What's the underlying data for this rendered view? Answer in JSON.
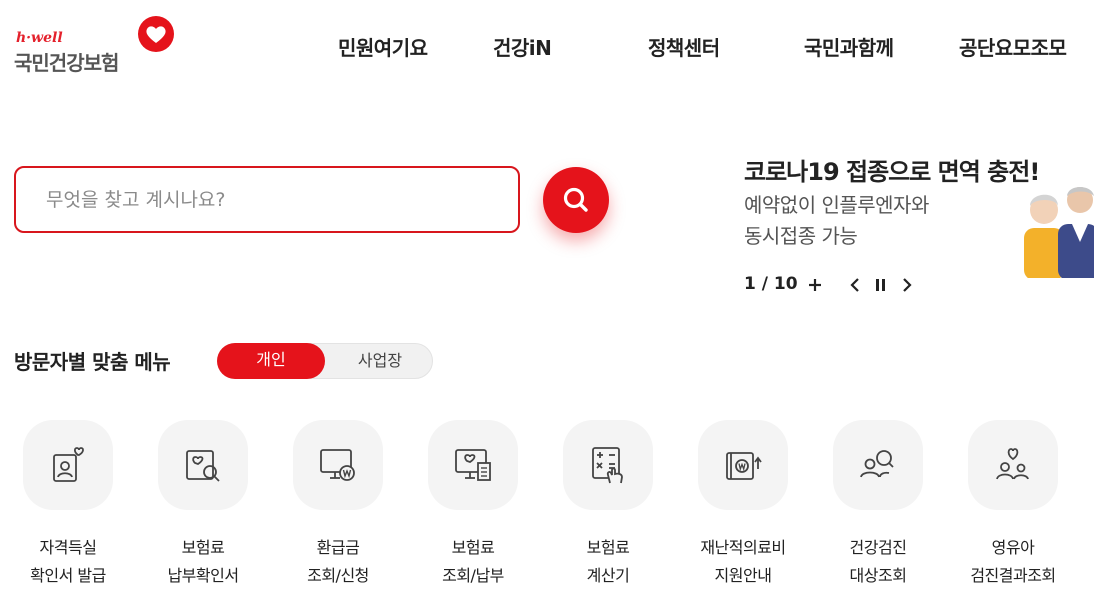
{
  "brand": {
    "sub": "h·well",
    "name": "국민건강보험"
  },
  "gnb": [
    "민원여기요",
    "건강iN",
    "정책센터",
    "국민과함께",
    "공단요모조모"
  ],
  "search": {
    "placeholder": "무엇을 찾고 계시나요?",
    "value": ""
  },
  "banner": {
    "title": "코로나19 접종으로 면역 충전!",
    "desc_line1": "예약없이 인플루엔자와",
    "desc_line2": "동시접종 가능",
    "pager": "1 / 10"
  },
  "persona": {
    "title": "방문자별 맞춤 메뉴",
    "tab_personal": "개인",
    "tab_business": "사업장"
  },
  "quick": [
    {
      "line1": "자격득실",
      "line2": "확인서 발급",
      "icon": "id-heart-icon"
    },
    {
      "line1": "보험료",
      "line2": "납부확인서",
      "icon": "document-search-icon"
    },
    {
      "line1": "환급금",
      "line2": "조회/신청",
      "icon": "monitor-won-icon"
    },
    {
      "line1": "보험료",
      "line2": "조회/납부",
      "icon": "monitor-bill-icon"
    },
    {
      "line1": "보험료",
      "line2": "계산기",
      "icon": "calculator-icon"
    },
    {
      "line1": "재난적의료비",
      "line2": "지원안내",
      "icon": "wallet-won-icon"
    },
    {
      "line1": "건강검진",
      "line2": "대상조회",
      "icon": "people-search-icon"
    },
    {
      "line1": "영유아",
      "line2": "검진결과조회",
      "icon": "family-heart-icon"
    }
  ],
  "colors": {
    "accent": "#e5131b",
    "text": "#222222",
    "tile_bg": "#f4f4f4"
  }
}
